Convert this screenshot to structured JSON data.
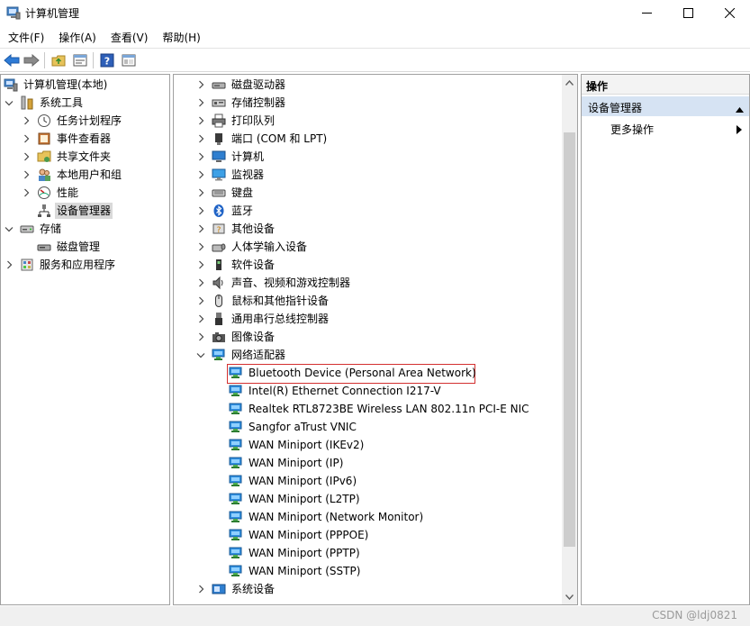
{
  "window": {
    "title": "计算机管理",
    "controls": {
      "minimize": "minimize",
      "maximize": "maximize",
      "close": "close"
    }
  },
  "menu": [
    "文件(F)",
    "操作(A)",
    "查看(V)",
    "帮助(H)"
  ],
  "toolbar": {
    "buttons": [
      "back-arrow-icon",
      "forward-arrow-icon",
      "up-folder-icon",
      "properties-icon",
      "help-icon",
      "show-hide-tree-icon"
    ]
  },
  "left_tree": {
    "root": "计算机管理(本地)",
    "items": [
      {
        "label": "系统工具",
        "level": 1,
        "expanded": true,
        "icon": "tools-icon"
      },
      {
        "label": "任务计划程序",
        "level": 2,
        "icon": "clock-icon"
      },
      {
        "label": "事件查看器",
        "level": 2,
        "icon": "event-icon"
      },
      {
        "label": "共享文件夹",
        "level": 2,
        "icon": "shared-folder-icon"
      },
      {
        "label": "本地用户和组",
        "level": 2,
        "icon": "users-icon"
      },
      {
        "label": "性能",
        "level": 2,
        "icon": "performance-icon"
      },
      {
        "label": "设备管理器",
        "level": 2,
        "icon": "device-manager-icon",
        "selected": true
      },
      {
        "label": "存储",
        "level": 1,
        "expanded": true,
        "icon": "storage-icon"
      },
      {
        "label": "磁盘管理",
        "level": 2,
        "icon": "disk-management-icon"
      },
      {
        "label": "服务和应用程序",
        "level": 1,
        "icon": "services-icon"
      }
    ]
  },
  "device_tree": {
    "categories_top": [
      {
        "label": "磁盘驱动器",
        "icon": "disk-drive-icon"
      },
      {
        "label": "存储控制器",
        "icon": "storage-controller-icon"
      },
      {
        "label": "打印队列",
        "icon": "printer-icon"
      },
      {
        "label": "端口 (COM 和 LPT)",
        "icon": "port-icon"
      },
      {
        "label": "计算机",
        "icon": "computer-icon"
      },
      {
        "label": "监视器",
        "icon": "monitor-icon"
      },
      {
        "label": "键盘",
        "icon": "keyboard-icon"
      },
      {
        "label": "蓝牙",
        "icon": "bluetooth-icon"
      },
      {
        "label": "其他设备",
        "icon": "other-devices-icon"
      },
      {
        "label": "人体学输入设备",
        "icon": "hid-icon"
      },
      {
        "label": "软件设备",
        "icon": "software-device-icon"
      },
      {
        "label": "声音、视频和游戏控制器",
        "icon": "sound-icon"
      },
      {
        "label": "鼠标和其他指针设备",
        "icon": "mouse-icon"
      },
      {
        "label": "通用串行总线控制器",
        "icon": "usb-icon"
      },
      {
        "label": "图像设备",
        "icon": "camera-icon"
      }
    ],
    "network": {
      "label": "网络适配器",
      "children": [
        "Bluetooth Device (Personal Area Network)",
        "Intel(R) Ethernet Connection I217-V",
        "Realtek RTL8723BE Wireless LAN 802.11n PCI-E NIC",
        "Sangfor aTrust VNIC",
        "WAN Miniport (IKEv2)",
        "WAN Miniport (IP)",
        "WAN Miniport (IPv6)",
        "WAN Miniport (L2TP)",
        "WAN Miniport (Network Monitor)",
        "WAN Miniport (PPPOE)",
        "WAN Miniport (PPTP)",
        "WAN Miniport (SSTP)"
      ]
    },
    "categories_bottom": [
      {
        "label": "系统设备",
        "icon": "system-devices-icon"
      }
    ]
  },
  "actions": {
    "header": "操作",
    "section": "设备管理器",
    "more": "更多操作"
  },
  "watermark": "CSDN @ldj0821",
  "colors": {
    "highlight_box": "#d32f2f",
    "selection": "#d9d9d9",
    "action_section": "#d6e3f3"
  }
}
